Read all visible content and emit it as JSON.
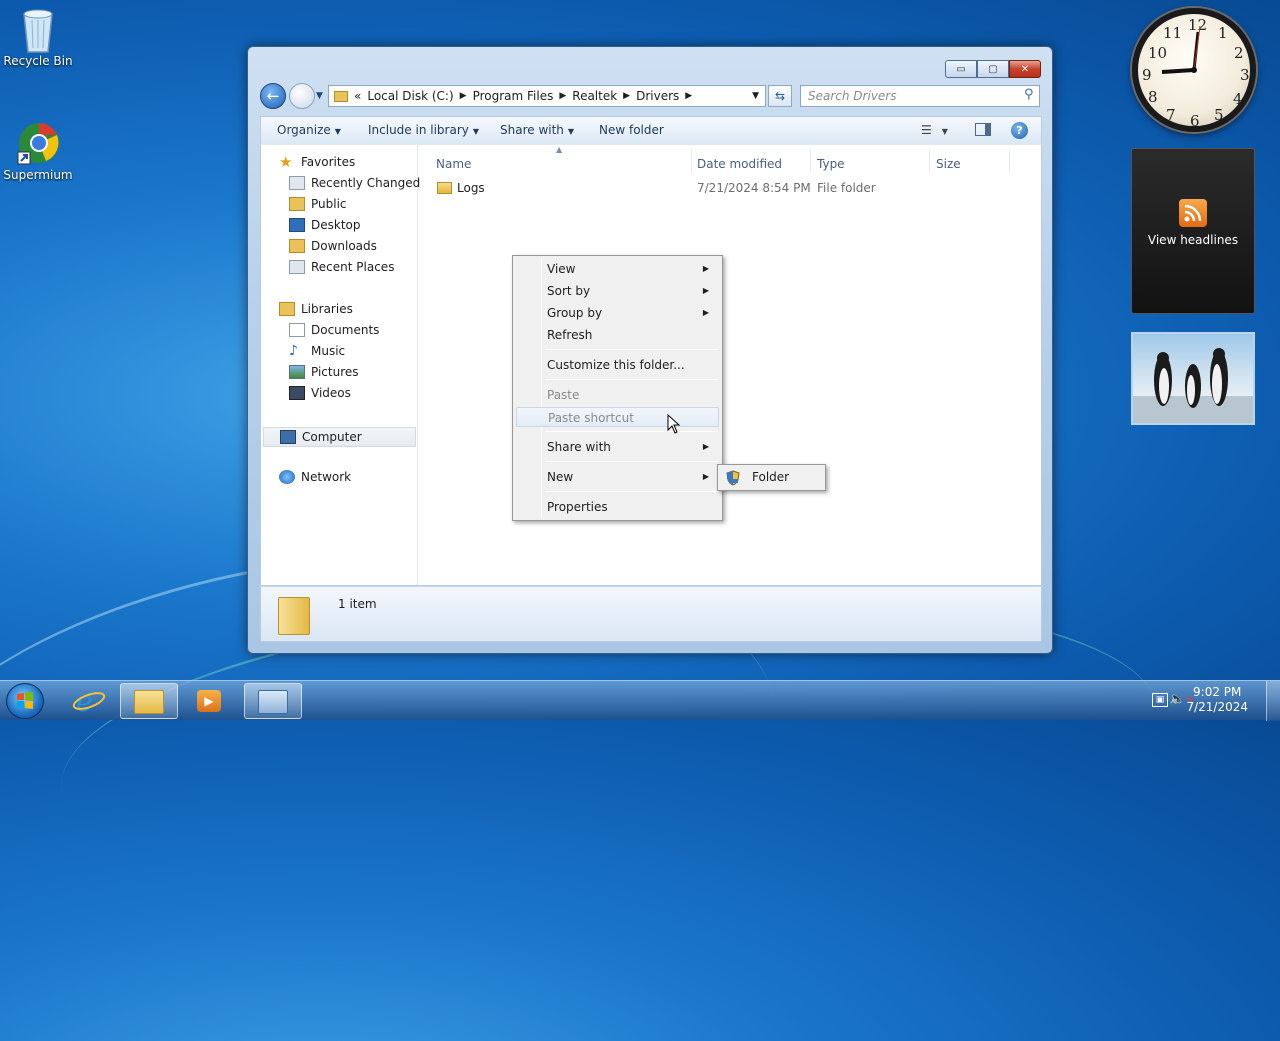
{
  "desktop": {
    "icons": [
      {
        "label": "Recycle Bin",
        "icon": "recycle-bin-icon"
      },
      {
        "label": "Supermium",
        "icon": "browser-icon"
      }
    ],
    "gadgets": {
      "clock_numbers": [
        "12",
        "1",
        "2",
        "3",
        "4",
        "5",
        "6",
        "7",
        "8",
        "9",
        "10",
        "11"
      ],
      "rss_label": "View headlines"
    }
  },
  "window": {
    "caption_buttons": {
      "minimize": "▭",
      "maximize": "▢",
      "close": "✕"
    },
    "address": {
      "prefix": "«",
      "segments": [
        "Local Disk (C:)",
        "Program Files",
        "Realtek",
        "Drivers"
      ]
    },
    "search_placeholder": "Search Drivers",
    "toolbar": {
      "organize": "Organize",
      "include_in_library": "Include in library",
      "share_with": "Share with",
      "new_folder": "New folder"
    },
    "nav": {
      "favorites": "Favorites",
      "favorites_items": [
        "Recently Changed",
        "Public",
        "Desktop",
        "Downloads",
        "Recent Places"
      ],
      "libraries": "Libraries",
      "libraries_items": [
        "Documents",
        "Music",
        "Pictures",
        "Videos"
      ],
      "computer": "Computer",
      "network": "Network"
    },
    "columns": {
      "name": "Name",
      "date": "Date modified",
      "type": "Type",
      "size": "Size"
    },
    "files": [
      {
        "name": "Logs",
        "date": "7/21/2024 8:54 PM",
        "type": "File folder",
        "size": ""
      }
    ],
    "status": {
      "count": "1 item"
    }
  },
  "context_menu": {
    "items": [
      "View",
      "Sort by",
      "Group by",
      "Refresh",
      "Customize this folder...",
      "Paste",
      "Paste shortcut",
      "Share with",
      "New",
      "Properties"
    ],
    "submenu_new": [
      "Folder"
    ]
  },
  "taskbar": {
    "time": "9:02 PM",
    "date": "7/21/2024"
  },
  "colors": {
    "desktop": "#1b78cc",
    "window_frame": "#b9d1ea",
    "close_button": "#c8422b",
    "disabled_text": "#8a8a8a",
    "link_text": "#1e3a5f"
  }
}
